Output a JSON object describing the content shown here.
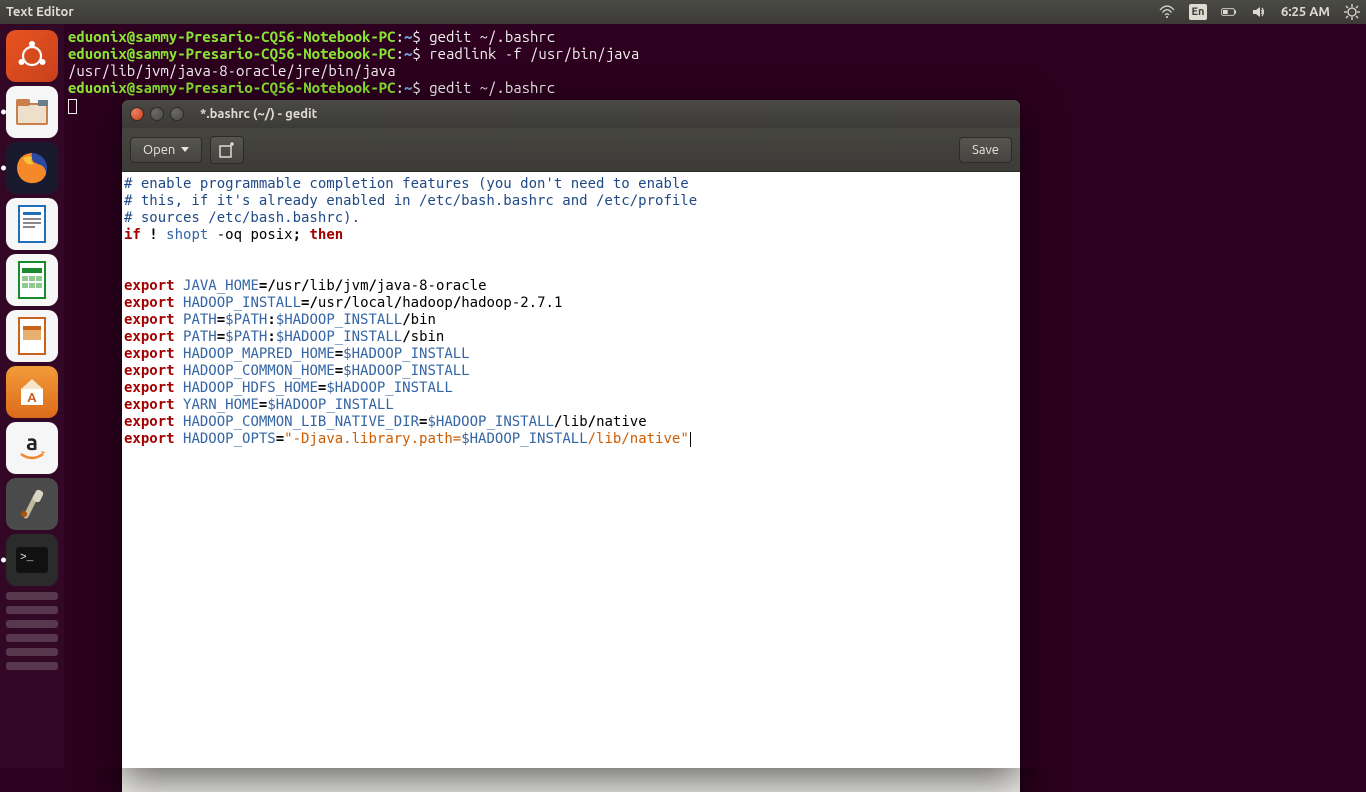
{
  "menubar": {
    "app_title": "Text Editor",
    "lang": "En",
    "clock": "6:25 AM"
  },
  "launcher": {
    "items": [
      {
        "name": "dash",
        "label": "Dash"
      },
      {
        "name": "files",
        "label": "Files"
      },
      {
        "name": "firefox",
        "label": "Firefox"
      },
      {
        "name": "writer",
        "label": "LibreOffice Writer"
      },
      {
        "name": "calc",
        "label": "LibreOffice Calc"
      },
      {
        "name": "impress",
        "label": "LibreOffice Impress"
      },
      {
        "name": "software",
        "label": "Ubuntu Software"
      },
      {
        "name": "amazon",
        "label": "Amazon"
      },
      {
        "name": "settings",
        "label": "System Settings"
      },
      {
        "name": "terminal",
        "label": "Terminal"
      },
      {
        "name": "gedit",
        "label": "Text Editor"
      }
    ]
  },
  "terminal": {
    "prompt_user_host": "eduonix@sammy-Presario-CQ56-Notebook-PC",
    "prompt_path": "~",
    "prompt_symbol": "$",
    "lines": {
      "cmd1": "gedit ~/.bashrc",
      "cmd2": "readlink -f /usr/bin/java",
      "out2": "/usr/lib/jvm/java-8-oracle/jre/bin/java",
      "cmd3": "gedit ~/.bashrc"
    }
  },
  "gedit": {
    "window_title": "*.bashrc (~/) - gedit",
    "open_label": "Open",
    "save_label": "Save",
    "tokens": {
      "cmt1": "# enable programmable completion features (you don't need to enable",
      "cmt2": "# this, if it's already enabled in /etc/bash.bashrc and /etc/profile",
      "cmt3": "# sources /etc/bash.bashrc).",
      "if": "if",
      "bang": "!",
      "shopt": "shopt",
      "shopt_args": " -oq posix",
      "semi": ";",
      "then": "then",
      "export": "export",
      "eq": "=",
      "colon": ":",
      "slash": "/",
      "dollar": "$",
      "quote": "\"",
      "java_home": "JAVA_HOME",
      "java_home_path": "/usr/lib/jvm/java-8-oracle",
      "hadoop_install": "HADOOP_INSTALL",
      "hadoop_install_path": "/usr/local/hadoop/hadoop-2.7.1",
      "path": "PATH",
      "path_var": "$PATH",
      "hi_var": "$HADOOP_INSTALL",
      "bin": "bin",
      "sbin": "sbin",
      "mapred": "HADOOP_MAPRED_HOME",
      "common": "HADOOP_COMMON_HOME",
      "hdfs": "HADOOP_HDFS_HOME",
      "yarn": "YARN_HOME",
      "native_dir": "HADOOP_COMMON_LIB_NATIVE_DIR",
      "lib": "lib",
      "native": "native",
      "opts": "HADOOP_OPTS",
      "opts_str_pre": "-Djava.library.path=",
      "opts_str_post": "/lib/native"
    }
  }
}
